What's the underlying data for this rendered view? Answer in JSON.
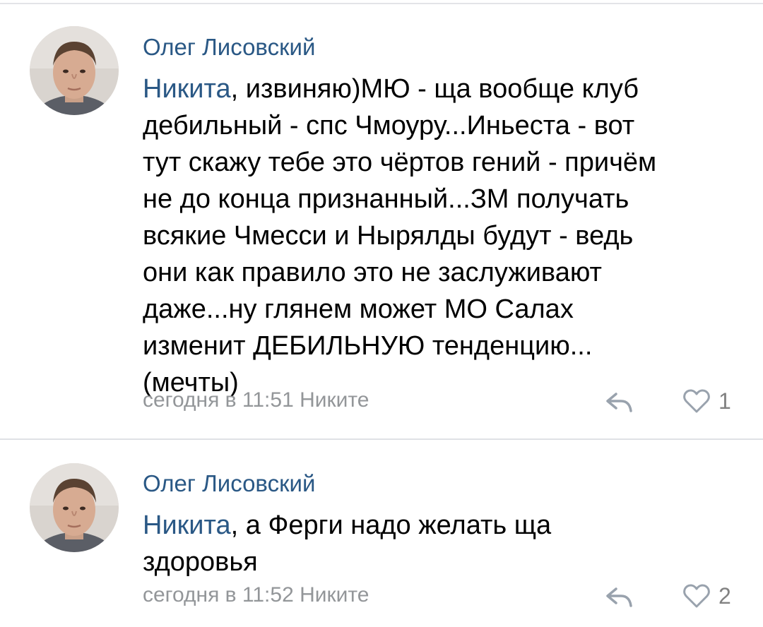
{
  "comments": [
    {
      "author": "Олег Лисовский",
      "mention": "Никита",
      "text_lines": [
        ", извиняю)МЮ - ща вообще клуб",
        "дебильный - спс Чмоуру...Иньеста - вот",
        "тут скажу тебе это чёртов гений - причём",
        "не до конца признанный...ЗМ получать",
        "всякие Чмесси и Нырялды будут - ведь",
        "они как правило это не заслуживают",
        "даже...ну глянем может МО Салах",
        "изменит ДЕБИЛЬНУЮ тенденцию...",
        "(мечты)"
      ],
      "meta": "сегодня в 11:51 Никите",
      "likes": "1",
      "reply_icon": "reply-arrow-icon",
      "like_icon": "heart-outline-icon"
    },
    {
      "author": "Олег Лисовский",
      "mention": "Никита",
      "text_lines": [
        ", а Ферги надо желать ща",
        "здоровья"
      ],
      "meta": "сегодня в 11:52 Никите",
      "likes": "2",
      "reply_icon": "reply-arrow-icon",
      "like_icon": "heart-outline-icon"
    }
  ],
  "colors": {
    "link": "#2a5885",
    "meta": "#939699",
    "icon": "#99a2ad",
    "divider": "#dfe1e5"
  }
}
